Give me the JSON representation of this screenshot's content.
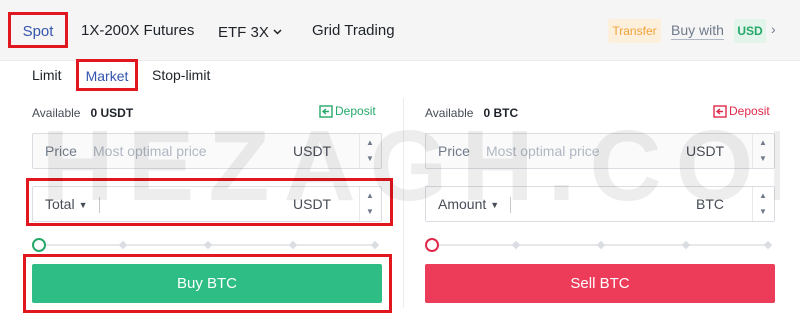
{
  "tabs": {
    "spot": "Spot",
    "futures": "1X-200X Futures",
    "etf": "ETF 3X",
    "grid": "Grid Trading"
  },
  "header": {
    "transfer": "Transfer",
    "buy_with": "Buy with",
    "currency": "USD"
  },
  "order_types": {
    "limit": "Limit",
    "market": "Market",
    "stop_limit": "Stop-limit"
  },
  "buy": {
    "available_label": "Available",
    "available_value": "0 USDT",
    "deposit": "Deposit",
    "price_label": "Price",
    "price_placeholder": "Most optimal price",
    "price_unit": "USDT",
    "total_label": "Total",
    "total_unit": "USDT",
    "button": "Buy BTC",
    "slider_percent": 0
  },
  "sell": {
    "available_label": "Available",
    "available_value": "0 BTC",
    "deposit": "Deposit",
    "price_label": "Price",
    "price_placeholder": "Most optimal price",
    "price_unit": "USDT",
    "amount_label": "Amount",
    "amount_unit": "BTC",
    "button": "Sell BTC",
    "slider_percent": 0
  },
  "watermark": "CHEZAGH.COM",
  "colors": {
    "buy": "#2ebd85",
    "sell": "#ec3c5a",
    "highlight": "#e0171f",
    "active_tab": "#3455ad"
  }
}
